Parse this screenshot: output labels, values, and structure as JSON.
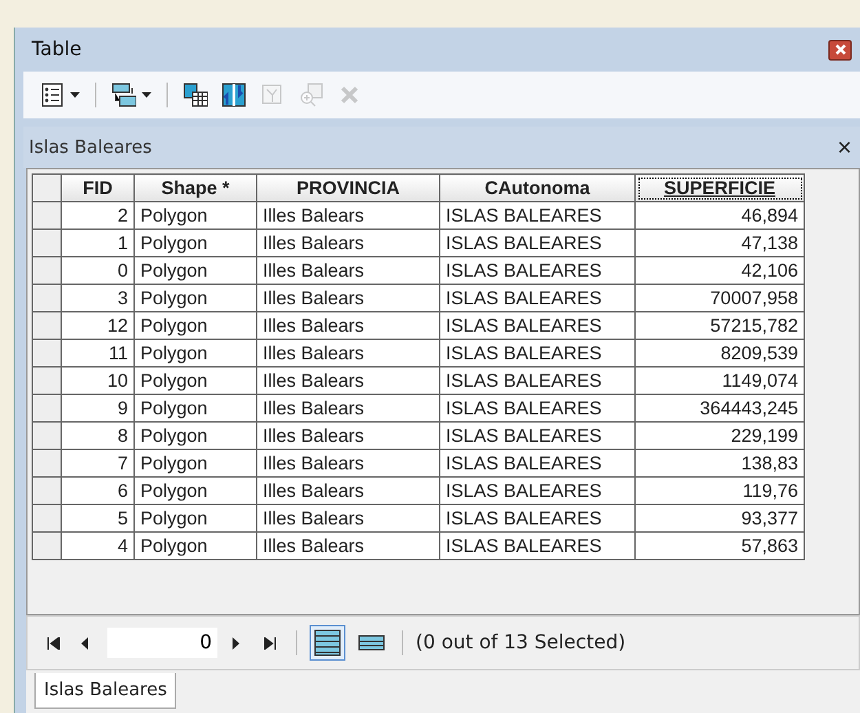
{
  "window": {
    "title": "Table"
  },
  "toolbar": [
    {
      "kind": "options",
      "dropdown": true,
      "disabled": false
    },
    {
      "kind": "related",
      "dropdown": true,
      "disabled": false
    },
    {
      "kind": "select",
      "dropdown": false,
      "disabled": false
    },
    {
      "kind": "switch",
      "dropdown": false,
      "disabled": false
    },
    {
      "kind": "clear",
      "dropdown": false,
      "disabled": true
    },
    {
      "kind": "zoom",
      "dropdown": false,
      "disabled": true
    },
    {
      "kind": "delete",
      "dropdown": false,
      "disabled": true
    }
  ],
  "panel": {
    "title": "Islas Baleares",
    "close": "×"
  },
  "table": {
    "columns": [
      {
        "label": "FID",
        "kind": "number",
        "focused": false
      },
      {
        "label": "Shape *",
        "kind": "text",
        "focused": false
      },
      {
        "label": "PROVINCIA",
        "kind": "text",
        "focused": false
      },
      {
        "label": "CAutonoma",
        "kind": "text",
        "focused": false
      },
      {
        "label": "SUPERFICIE",
        "kind": "number",
        "focused": true
      }
    ],
    "rows": [
      [
        "2",
        "Polygon",
        "Illes Balears",
        "ISLAS BALEARES",
        "46,894"
      ],
      [
        "1",
        "Polygon",
        "Illes Balears",
        "ISLAS BALEARES",
        "47,138"
      ],
      [
        "0",
        "Polygon",
        "Illes Balears",
        "ISLAS BALEARES",
        "42,106"
      ],
      [
        "3",
        "Polygon",
        "Illes Balears",
        "ISLAS BALEARES",
        "70007,958"
      ],
      [
        "12",
        "Polygon",
        "Illes Balears",
        "ISLAS BALEARES",
        "57215,782"
      ],
      [
        "11",
        "Polygon",
        "Illes Balears",
        "ISLAS BALEARES",
        "8209,539"
      ],
      [
        "10",
        "Polygon",
        "Illes Balears",
        "ISLAS BALEARES",
        "1149,074"
      ],
      [
        "9",
        "Polygon",
        "Illes Balears",
        "ISLAS BALEARES",
        "364443,245"
      ],
      [
        "8",
        "Polygon",
        "Illes Balears",
        "ISLAS BALEARES",
        "229,199"
      ],
      [
        "7",
        "Polygon",
        "Illes Balears",
        "ISLAS BALEARES",
        "138,83"
      ],
      [
        "6",
        "Polygon",
        "Illes Balears",
        "ISLAS BALEARES",
        "119,76"
      ],
      [
        "5",
        "Polygon",
        "Illes Balears",
        "ISLAS BALEARES",
        "93,377"
      ],
      [
        "4",
        "Polygon",
        "Illes Balears",
        "ISLAS BALEARES",
        "57,863"
      ]
    ]
  },
  "navigator": {
    "record": "0",
    "views": [
      {
        "kind": "all",
        "selected": true
      },
      {
        "kind": "selected",
        "selected": false
      }
    ],
    "status": "(0 out of 13 Selected)"
  },
  "tabs": [
    {
      "label": "Islas Baleares",
      "selected": true
    }
  ]
}
